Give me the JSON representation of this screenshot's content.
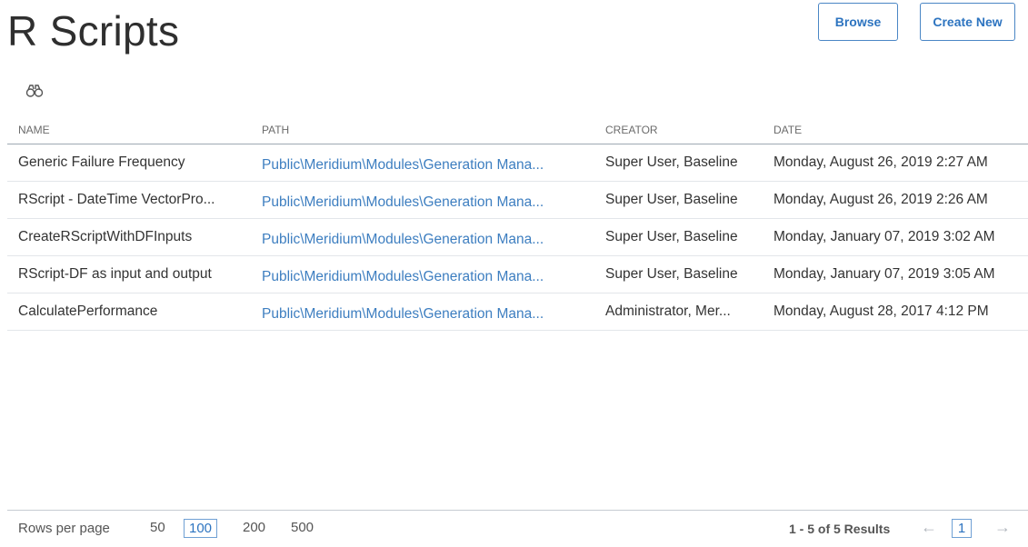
{
  "page": {
    "title": "R Scripts"
  },
  "toolbar": {
    "browse_label": "Browse",
    "create_label": "Create New"
  },
  "icons": {
    "search": "binoculars-icon",
    "prev": "arrow-left-icon",
    "next": "arrow-right-icon"
  },
  "colors": {
    "accent": "#2d74c0",
    "link": "#3d7ec0",
    "text": "#333333"
  },
  "table": {
    "headers": {
      "name": "NAME",
      "path": "PATH",
      "creator": "CREATOR",
      "date": "DATE"
    },
    "rows": [
      {
        "name": "Generic Failure Frequency",
        "path": "Public\\Meridium\\Modules\\Generation Mana...",
        "creator": "Super User, Baseline",
        "date": "Monday, August 26, 2019 2:27 AM"
      },
      {
        "name": "RScript - DateTime VectorPro...",
        "path": "Public\\Meridium\\Modules\\Generation Mana...",
        "creator": "Super User, Baseline",
        "date": "Monday, August 26, 2019 2:26 AM"
      },
      {
        "name": "CreateRScriptWithDFInputs",
        "path": "Public\\Meridium\\Modules\\Generation Mana...",
        "creator": "Super User, Baseline",
        "date": "Monday, January 07, 2019 3:02 AM"
      },
      {
        "name": "RScript-DF as input and output",
        "path": "Public\\Meridium\\Modules\\Generation Mana...",
        "creator": "Super User, Baseline",
        "date": "Monday, January 07, 2019 3:05 AM"
      },
      {
        "name": "CalculatePerformance",
        "path": "Public\\Meridium\\Modules\\Generation Mana...",
        "creator": "Administrator, Mer...",
        "date": "Monday, August 28, 2017 4:12 PM"
      }
    ]
  },
  "pagination": {
    "rows_per_page_label": "Rows per page",
    "options": [
      "50",
      "100",
      "200",
      "500"
    ],
    "selected_option": "100",
    "results_text": "1 - 5 of 5 Results",
    "current_page": "1",
    "prev_glyph": "←",
    "next_glyph": "→"
  }
}
